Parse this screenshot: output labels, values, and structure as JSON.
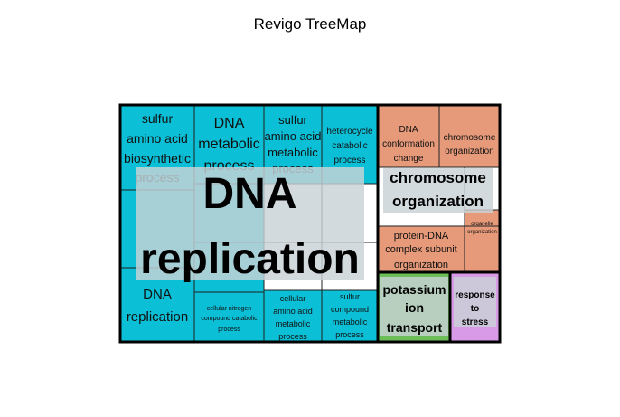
{
  "chart_data": {
    "type": "treemap",
    "title": "Revigo TreeMap",
    "colors": {
      "cyan": "#0bbfd6",
      "salmon": "#e69a7a",
      "green": "#6cbf58",
      "violet": "#d89ae6",
      "label_box": "#c9d2d6"
    },
    "groups": [
      {
        "name": "DNA replication",
        "color": "cyan",
        "terms": [
          {
            "label": "sulfur amino acid biosynthetic process",
            "color": "cyan"
          },
          {
            "label": "DNA metabolic process",
            "color": "cyan"
          },
          {
            "label": "sulfur amino acid metabolic process",
            "color": "cyan"
          },
          {
            "label": "heterocycle catabolic process",
            "color": "cyan"
          },
          {
            "label": "DNA replication",
            "color": "cyan"
          },
          {
            "label": "cellular nitrogen compound catabolic process",
            "color": "cyan"
          },
          {
            "label": "cellular amino acid metabolic process",
            "color": "cyan"
          },
          {
            "label": "sulfur compound metabolic process",
            "color": "cyan"
          }
        ]
      },
      {
        "name": "chromosome organization",
        "color": "salmon",
        "terms": [
          {
            "label": "DNA conformation change",
            "color": "salmon"
          },
          {
            "label": "chromosome organization",
            "color": "salmon"
          },
          {
            "label": "protein-DNA complex subunit organization",
            "color": "salmon"
          },
          {
            "label": "organelle organization",
            "color": "salmon"
          }
        ]
      },
      {
        "name": "potassium ion transport",
        "color": "green",
        "terms": [
          {
            "label": "potassium ion transport",
            "color": "green"
          }
        ]
      },
      {
        "name": "response to stress",
        "color": "violet",
        "terms": [
          {
            "label": "response to stress",
            "color": "violet"
          }
        ]
      }
    ]
  }
}
